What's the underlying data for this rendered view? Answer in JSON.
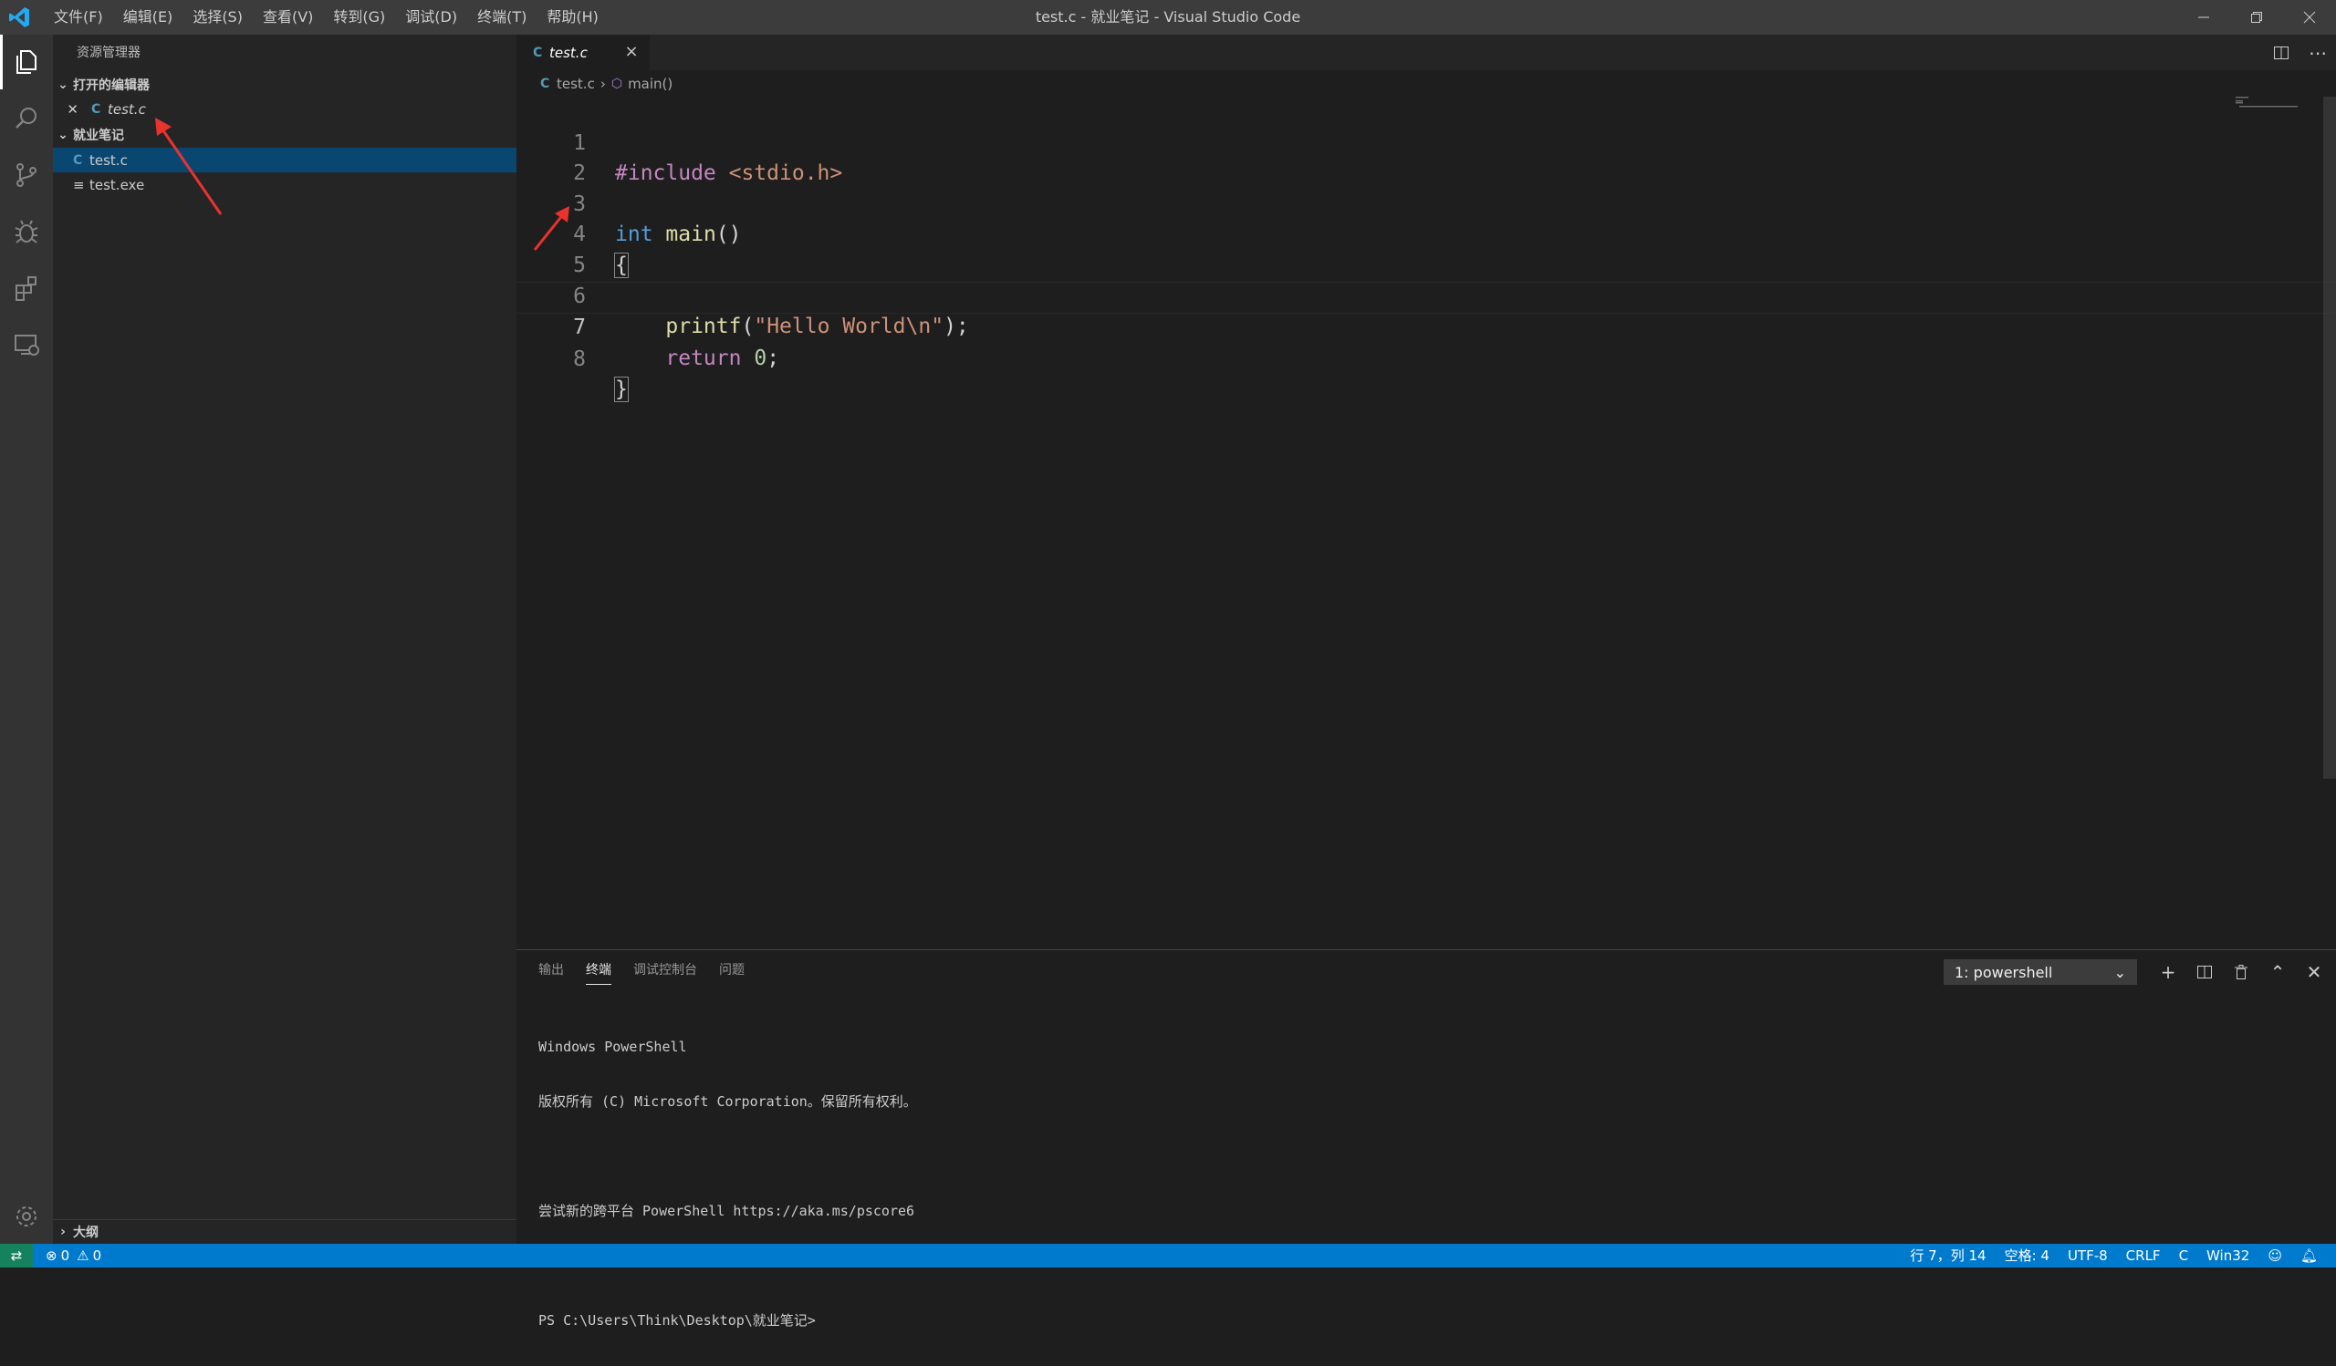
{
  "window": {
    "title": "test.c - 就业笔记 - Visual Studio Code",
    "menu": [
      "文件(F)",
      "编辑(E)",
      "选择(S)",
      "查看(V)",
      "转到(G)",
      "调试(D)",
      "终端(T)",
      "帮助(H)"
    ]
  },
  "activity_bar": {
    "icons": [
      "explorer-icon",
      "search-icon",
      "source-control-icon",
      "debug-icon",
      "extensions-icon",
      "remote-explorer-icon",
      "settings-gear-icon"
    ]
  },
  "sidebar": {
    "title": "资源管理器",
    "open_editors": {
      "label": "打开的编辑器",
      "items": [
        {
          "icon": "C",
          "name": "test.c"
        }
      ]
    },
    "folder": {
      "label": "就业笔记",
      "items": [
        {
          "icon": "C",
          "name": "test.c",
          "selected": true
        },
        {
          "icon": "≡",
          "name": "test.exe",
          "selected": false
        }
      ]
    },
    "outline_label": "大纲"
  },
  "editor": {
    "tab": {
      "icon": "C",
      "label": "test.c"
    },
    "breadcrumb": {
      "file": "test.c",
      "symbol": "main()"
    },
    "line_numbers": [
      "1",
      "2",
      "3",
      "4",
      "5",
      "6",
      "7",
      "8"
    ],
    "code": {
      "l1_directive": "#include",
      "l1_header": " <stdio.h>",
      "l3_type": "int",
      "l3_fn": "main",
      "l3_rest": "()",
      "l4": "{",
      "l6_fn": "printf",
      "l6_open": "(",
      "l6_str": "\"Hello World\\n\"",
      "l6_close": ");",
      "l7_kw": "return",
      "l7_num": "0",
      "l7_end": ";",
      "l8": "}"
    },
    "current_line": 7
  },
  "panel": {
    "tabs": [
      "输出",
      "终端",
      "调试控制台",
      "问题"
    ],
    "active_tab": "终端",
    "terminal_select": "1: powershell",
    "terminal_lines": [
      "Windows PowerShell",
      "版权所有 (C) Microsoft Corporation。保留所有权利。",
      "",
      "尝试新的跨平台 PowerShell https://aka.ms/pscore6",
      "",
      "PS C:\\Users\\Think\\Desktop\\就业笔记>"
    ]
  },
  "status_bar": {
    "errors": "0",
    "warnings": "0",
    "position": "行 7，列 14",
    "spaces": "空格: 4",
    "encoding": "UTF-8",
    "eol": "CRLF",
    "language": "C",
    "platform": "Win32"
  },
  "colors": {
    "titlebar": "#3c3c3c",
    "activitybar": "#333333",
    "sidebar": "#252526",
    "editor": "#1e1e1e",
    "statusbar": "#007acc",
    "selection": "#094771",
    "annotation_arrow": "#e8332f"
  }
}
